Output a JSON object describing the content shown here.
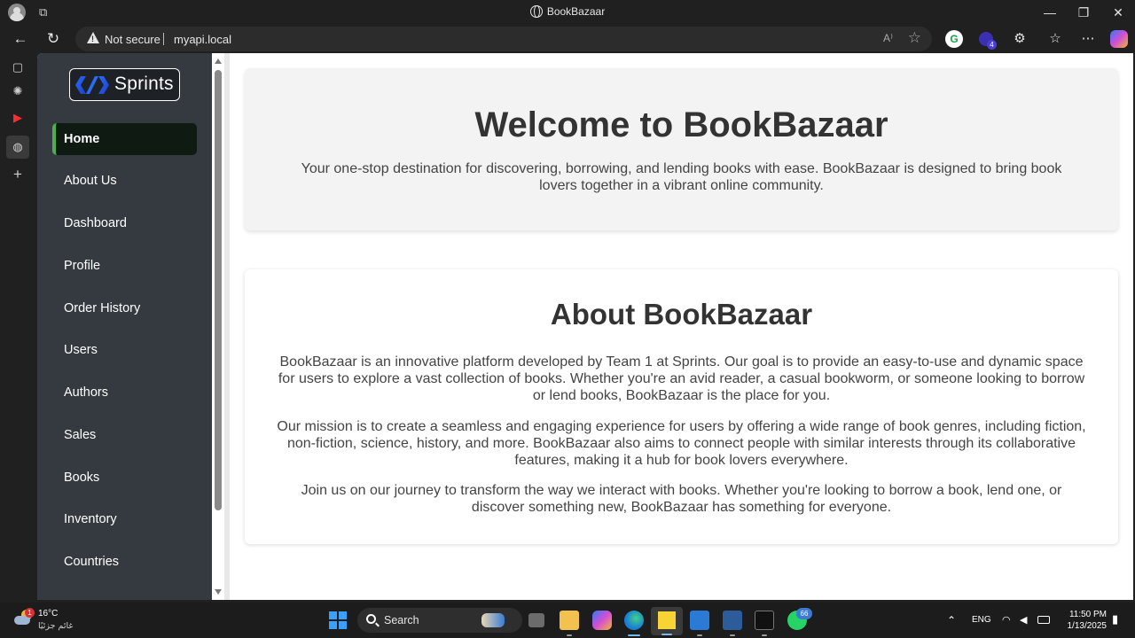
{
  "browser": {
    "window_title": "BookBazaar",
    "security_label": "Not secure",
    "url": "myapi.local",
    "read_aloud": "A⁾",
    "extension_badge": "4"
  },
  "app": {
    "logo_text": "Sprints",
    "nav": {
      "items": [
        {
          "label": "Home"
        },
        {
          "label": "About Us"
        },
        {
          "label": "Dashboard"
        },
        {
          "label": "Profile"
        },
        {
          "label": "Order History"
        },
        {
          "label": "Users"
        },
        {
          "label": "Authors"
        },
        {
          "label": "Sales"
        },
        {
          "label": "Books"
        },
        {
          "label": "Inventory"
        },
        {
          "label": "Countries"
        }
      ],
      "active": "Home"
    },
    "hero": {
      "title": "Welcome to BookBazaar",
      "text": "Your one-stop destination for discovering, borrowing, and lending books with ease. BookBazaar is designed to bring book lovers together in a vibrant online community."
    },
    "about": {
      "title": "About BookBazaar",
      "paragraphs": [
        "BookBazaar is an innovative platform developed by Team 1 at Sprints. Our goal is to provide an easy-to-use and dynamic space for users to explore a vast collection of books. Whether you're an avid reader, a casual bookworm, or someone looking to borrow or lend books, BookBazaar is the place for you.",
        "Our mission is to create a seamless and engaging experience for users by offering a wide range of book genres, including fiction, non-fiction, science, history, and more. BookBazaar also aims to connect people with similar interests through its collaborative features, making it a hub for book lovers everywhere.",
        "Join us on our journey to transform the way we interact with books. Whether you're looking to borrow a book, lend one, or discover something new, BookBazaar has something for everyone."
      ]
    }
  },
  "taskbar": {
    "weather_temp": "16°C",
    "weather_desc": "غائم جزئيًا",
    "weather_badge": "1",
    "search_label": "Search",
    "whatsapp_badge": "66",
    "language": "ENG",
    "time": "11:50 PM",
    "date": "1/13/2025"
  },
  "colors": {
    "nav_bg": "#343a40",
    "nav_active_bg": "#0e1a12",
    "nav_active_accent": "#4caf50",
    "hero_bg": "#f3f3f3",
    "heading": "#333333",
    "browser_chrome": "#202020"
  }
}
